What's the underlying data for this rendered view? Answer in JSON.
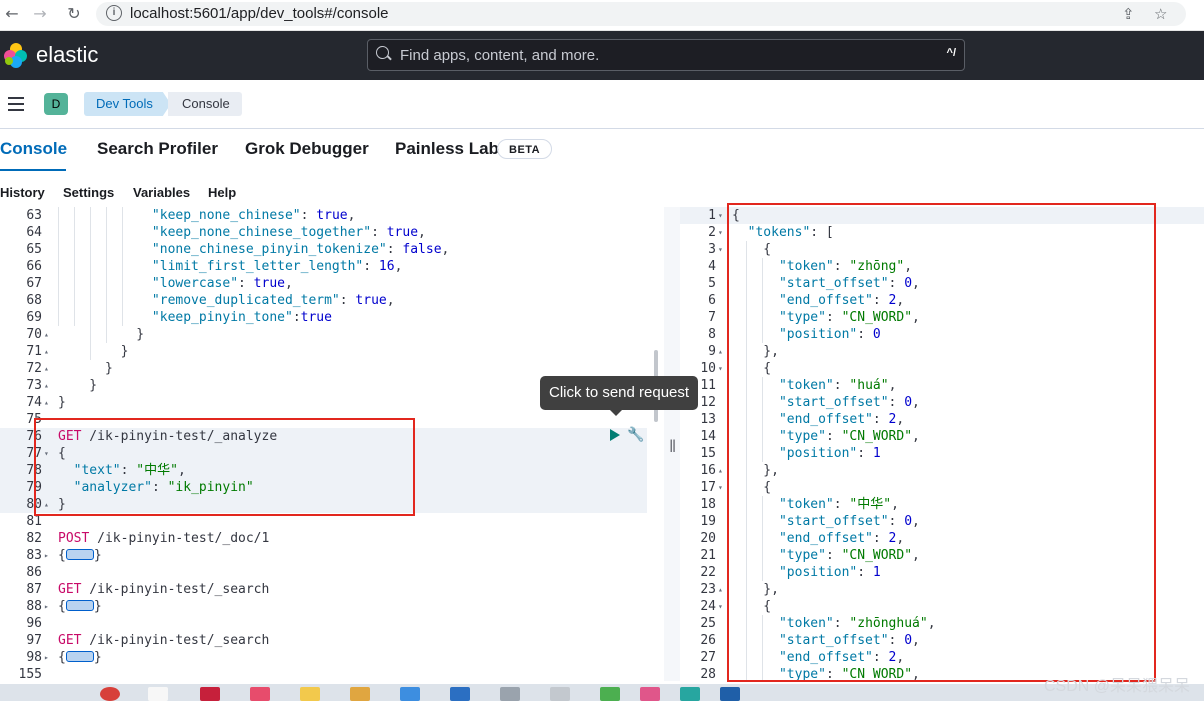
{
  "browser": {
    "url": "localhost:5601/app/dev_tools#/console"
  },
  "header": {
    "brand": "elastic",
    "search_placeholder": "Find apps, content, and more.",
    "search_shortcut": "^/"
  },
  "breadcrumbs": {
    "space": "D",
    "items": [
      "Dev Tools",
      "Console"
    ]
  },
  "tabs": [
    {
      "label": "Console"
    },
    {
      "label": "Search Profiler"
    },
    {
      "label": "Grok Debugger"
    },
    {
      "label": "Painless Lab"
    }
  ],
  "beta": "BETA",
  "menu": [
    "History",
    "Settings",
    "Variables",
    "Help"
  ],
  "tooltip": "Click to send request",
  "watermark": "CSDN @呆呆猥呆呆",
  "colors": {
    "header_bg": "#25282f",
    "accent": "#006bb8",
    "annotation": "#e2271e",
    "run_green": "#017d73"
  }
}
